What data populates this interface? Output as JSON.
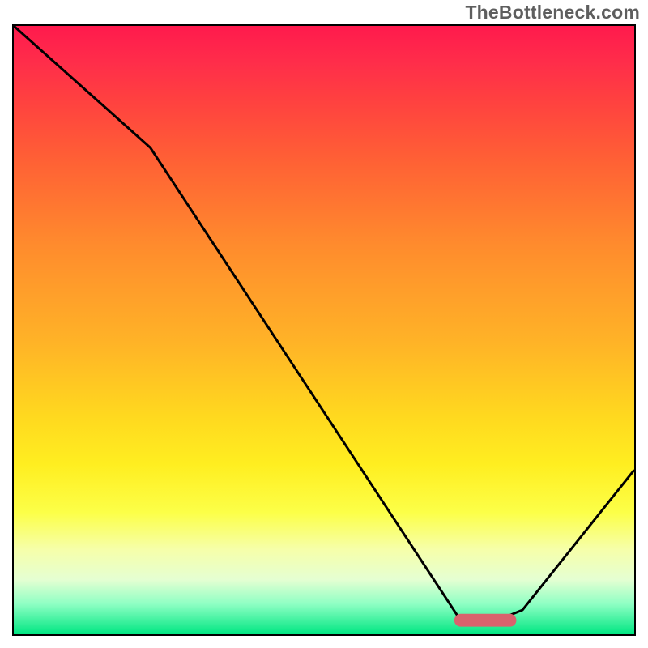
{
  "watermark": "TheBottleneck.com",
  "chart_data": {
    "type": "line",
    "title": "",
    "xlabel": "",
    "ylabel": "",
    "xlim": [
      0,
      100
    ],
    "ylim": [
      0,
      100
    ],
    "series": [
      {
        "name": "bottleneck-curve",
        "x": [
          0,
          22,
          72,
          78,
          82,
          100
        ],
        "values": [
          100,
          80,
          2.3,
          2.3,
          4,
          27
        ]
      }
    ],
    "marker": {
      "name": "optimal-range",
      "x_center": 76,
      "y": 2.3,
      "width": 10,
      "color": "#d9626d"
    },
    "gradient_colors": {
      "top": "#ff1a4d",
      "mid_upper": "#ff8b2d",
      "mid": "#ffd81f",
      "mid_lower": "#fcff48",
      "bottom": "#00e682"
    }
  }
}
